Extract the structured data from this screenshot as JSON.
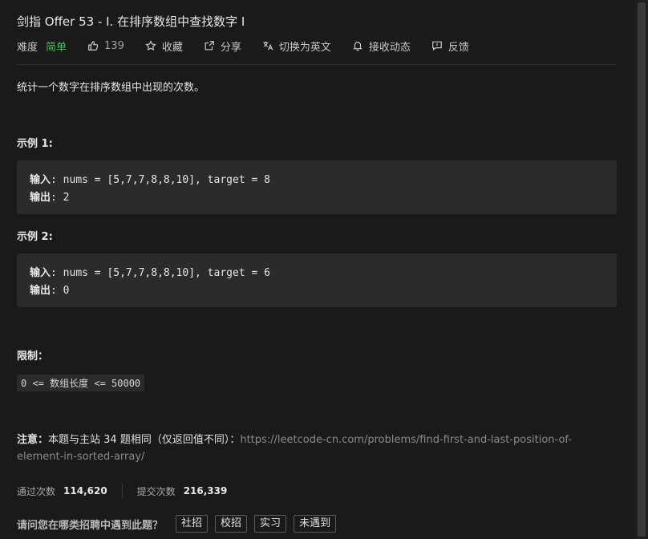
{
  "title": "剑指 Offer 53 - I. 在排序数组中查找数字 I",
  "meta": {
    "difficulty_label": "难度",
    "difficulty_value": "简单",
    "likes": "139",
    "favorite": "收藏",
    "share": "分享",
    "switch_lang": "切换为英文",
    "subscribe": "接收动态",
    "feedback": "反馈"
  },
  "description": "统计一个数字在排序数组中出现的次数。",
  "examples": [
    {
      "heading": "示例 1:",
      "input_label": "输入",
      "input_value": ": nums = [5,7,7,8,8,10], target = 8",
      "output_label": "输出",
      "output_value": ": 2"
    },
    {
      "heading": "示例 2:",
      "input_label": "输入",
      "input_value": ": nums = [5,7,7,8,8,10], target = 6",
      "output_label": "输出",
      "output_value": ": 0"
    }
  ],
  "constraints_heading": "限制：",
  "constraint": "0 <= 数组长度 <= 50000",
  "note": {
    "label": "注意：",
    "text": "本题与主站 34 题相同（仅返回值不同）：",
    "link": "https://leetcode-cn.com/problems/find-first-and-last-position-of-element-in-sorted-array/"
  },
  "stats": {
    "accepted_label": "通过次数",
    "accepted_value": "114,620",
    "submissions_label": "提交次数",
    "submissions_value": "216,339"
  },
  "survey": {
    "question": "请问您在哪类招聘中遇到此题？",
    "options": [
      "社招",
      "校招",
      "实习",
      "未遇到"
    ]
  },
  "colors": {
    "difficulty_easy": "#45c45a",
    "background": "#1a1a1a",
    "code_bg": "#2b2b2b"
  }
}
